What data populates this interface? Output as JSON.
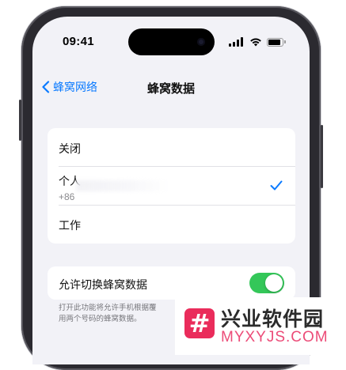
{
  "status_bar": {
    "time": "09:41"
  },
  "nav": {
    "back_label": "蜂窝网络",
    "title": "蜂窝数据"
  },
  "options": [
    {
      "label": "关闭"
    },
    {
      "label": "个人",
      "sub": "+86",
      "selected": true
    },
    {
      "label": "工作"
    }
  ],
  "switch_row": {
    "label": "允许切换蜂窝数据",
    "enabled": true
  },
  "footer_note": {
    "line1": "打开此功能将允许手机根据覆",
    "line2": "用两个号码的蜂窝数据。"
  },
  "watermark": {
    "logo_char": "#",
    "title": "兴业软件园",
    "url": "MYXYJS.COM"
  },
  "colors": {
    "accent": "#0a7aff",
    "toggle_on": "#34c759",
    "background": "#f2f2f7",
    "watermark_brand": "#ea2c5b"
  },
  "icons": {
    "back": "chevron-left-icon",
    "selected": "checkmark-icon",
    "signal": "cellular-signal-icon",
    "wifi": "wifi-icon",
    "battery": "battery-icon"
  }
}
